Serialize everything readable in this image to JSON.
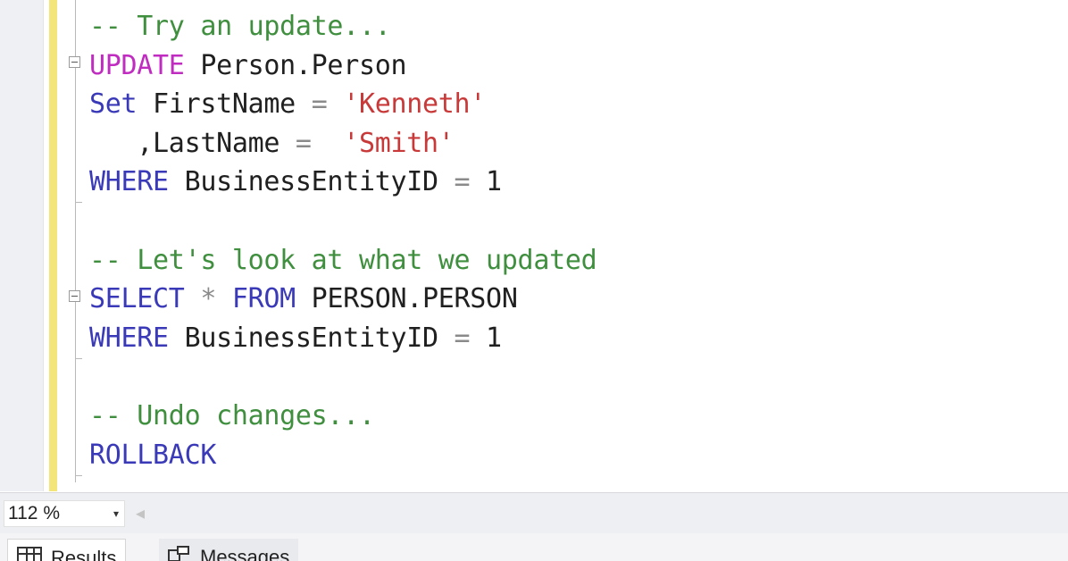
{
  "editor": {
    "lines": [
      [
        {
          "t": "-- Try an update...",
          "c": "cm"
        }
      ],
      [
        {
          "t": "UPDATE",
          "c": "pk"
        },
        {
          "t": " Person.Person",
          "c": "id"
        }
      ],
      [
        {
          "t": "Set",
          "c": "kw"
        },
        {
          "t": " FirstName ",
          "c": "id"
        },
        {
          "t": "=",
          "c": "op"
        },
        {
          "t": " ",
          "c": "id"
        },
        {
          "t": "'Kenneth'",
          "c": "str"
        }
      ],
      [
        {
          "t": "   ,LastName ",
          "c": "id"
        },
        {
          "t": "=",
          "c": "op"
        },
        {
          "t": "  ",
          "c": "id"
        },
        {
          "t": "'Smith'",
          "c": "str"
        }
      ],
      [
        {
          "t": "WHERE",
          "c": "kw"
        },
        {
          "t": " BusinessEntityID ",
          "c": "id"
        },
        {
          "t": "=",
          "c": "op"
        },
        {
          "t": " 1",
          "c": "id"
        }
      ],
      [],
      [
        {
          "t": "-- Let's look at what we updated",
          "c": "cm"
        }
      ],
      [
        {
          "t": "SELECT",
          "c": "kw"
        },
        {
          "t": " ",
          "c": "id"
        },
        {
          "t": "*",
          "c": "op"
        },
        {
          "t": " ",
          "c": "id"
        },
        {
          "t": "FROM",
          "c": "kw"
        },
        {
          "t": " PERSON.PERSON",
          "c": "id"
        }
      ],
      [
        {
          "t": "WHERE",
          "c": "kw"
        },
        {
          "t": " BusinessEntityID ",
          "c": "id"
        },
        {
          "t": "=",
          "c": "op"
        },
        {
          "t": " 1",
          "c": "id"
        }
      ],
      [],
      [
        {
          "t": "-- Undo changes...",
          "c": "cm"
        }
      ],
      [
        {
          "t": "ROLLBACK",
          "c": "kw"
        }
      ]
    ]
  },
  "statusbar": {
    "zoom_value": "112 %",
    "zoom_arrow": "▾",
    "scroll_left_glyph": "◂"
  },
  "results_tabs": {
    "results_label": "Results",
    "messages_label": "Messages"
  },
  "colors": {
    "comment": "#3f8f3f",
    "keyword": "#3a3ab8",
    "update_keyword": "#c02bc0",
    "string": "#c83a3a",
    "change_bar": "#f3e57a"
  },
  "icons": {
    "results_tab": "grid-icon",
    "messages_tab": "messages-icon",
    "fold_toggle": "collapse-icon"
  }
}
